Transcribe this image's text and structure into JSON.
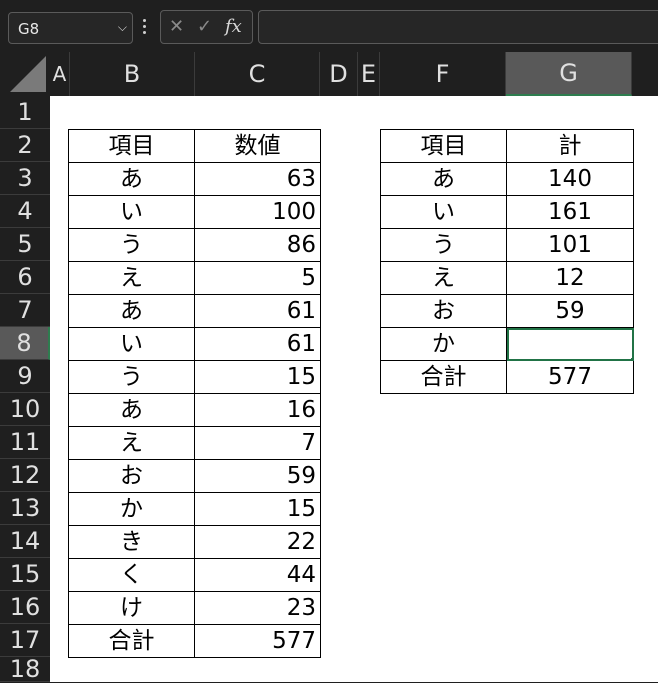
{
  "formula_bar": {
    "name_box": "G8",
    "cancel_glyph": "✕",
    "enter_glyph": "✓",
    "fx_label": "fx",
    "formula": ""
  },
  "columns": [
    "A",
    "B",
    "C",
    "D",
    "E",
    "F",
    "G"
  ],
  "selected_column": "G",
  "rows": [
    "1",
    "2",
    "3",
    "4",
    "5",
    "6",
    "7",
    "8",
    "9",
    "10",
    "11",
    "12",
    "13",
    "14",
    "15",
    "16",
    "17",
    "18"
  ],
  "selected_row": "8",
  "table1": {
    "header": [
      "項目",
      "数値"
    ],
    "rows": [
      [
        "あ",
        "63"
      ],
      [
        "い",
        "100"
      ],
      [
        "う",
        "86"
      ],
      [
        "え",
        "5"
      ],
      [
        "あ",
        "61"
      ],
      [
        "い",
        "61"
      ],
      [
        "う",
        "15"
      ],
      [
        "あ",
        "16"
      ],
      [
        "え",
        "7"
      ],
      [
        "お",
        "59"
      ],
      [
        "か",
        "15"
      ],
      [
        "き",
        "22"
      ],
      [
        "く",
        "44"
      ],
      [
        "け",
        "23"
      ],
      [
        "合計",
        "577"
      ]
    ]
  },
  "table2": {
    "header": [
      "項目",
      "計"
    ],
    "rows": [
      [
        "あ",
        "140"
      ],
      [
        "い",
        "161"
      ],
      [
        "う",
        "101"
      ],
      [
        "え",
        "12"
      ],
      [
        "お",
        "59"
      ],
      [
        "か",
        ""
      ],
      [
        "合計",
        "577"
      ]
    ]
  },
  "colors": {
    "selection": "#217346",
    "header_bg": "#1f1f1f",
    "selected_header_bg": "#595959"
  }
}
